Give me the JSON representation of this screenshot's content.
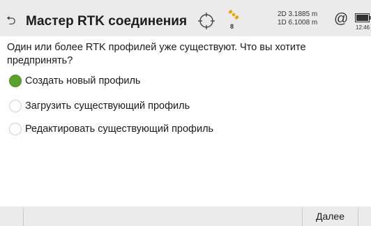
{
  "header": {
    "title": "Мастер RTK соединения",
    "satellite_count": "8",
    "precision_2d": "2D 3.1885 m",
    "precision_1d": "1D 6.1008 m",
    "clock": "12:46",
    "icons": [
      "back-icon",
      "crosshair-icon",
      "satellite-icon",
      "at-icon",
      "battery-icon"
    ],
    "satellite_color": "#e8a200"
  },
  "main": {
    "question": "Один или более RTK профилей уже существуют. Что вы хотите предпринять?",
    "options": [
      {
        "label": "Создать новый профиль",
        "selected": true
      },
      {
        "label": "Загрузить существующий профиль",
        "selected": false
      },
      {
        "label": "Редактировать существующий профиль",
        "selected": false
      }
    ],
    "accent_color": "#5aa02c"
  },
  "footer": {
    "next_label": "Далее"
  }
}
